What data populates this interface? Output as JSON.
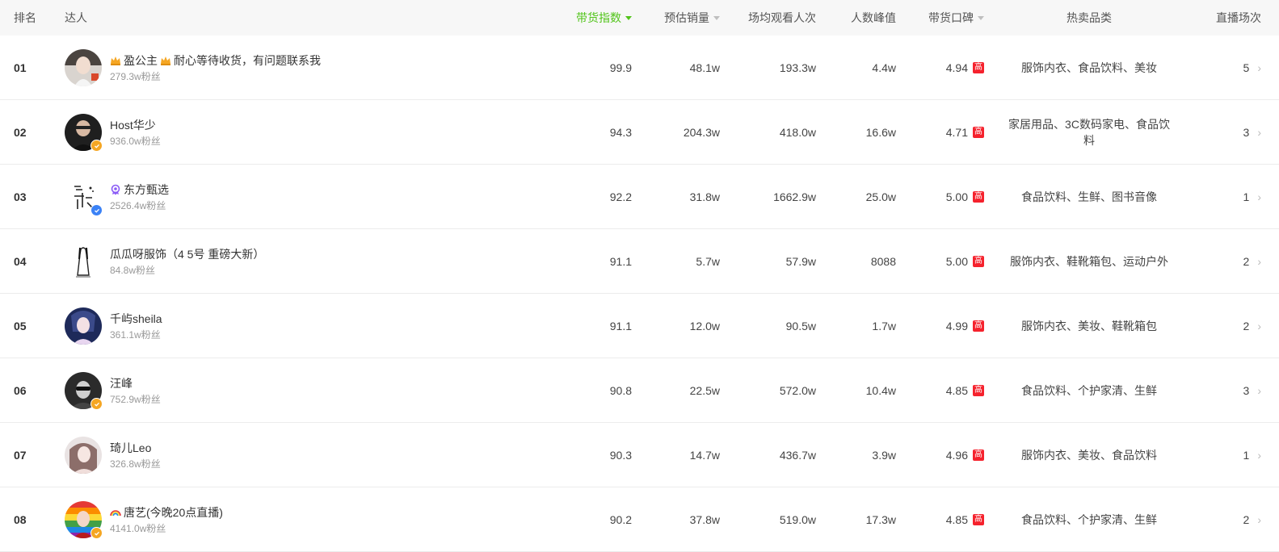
{
  "header": {
    "rank": "排名",
    "talent": "达人",
    "sales_index": "带货指数",
    "est_sales": "预估销量",
    "avg_views": "场均观看人次",
    "peak": "人数峰值",
    "reputation": "带货口碑",
    "hot_category": "热卖品类",
    "live_count": "直播场次"
  },
  "rows": [
    {
      "rank": "01",
      "name": "盈公主",
      "name_suffix": "耐心等待收货，有问题联系我",
      "fans": "279.3w粉丝",
      "index": "99.9",
      "sales": "48.1w",
      "views": "193.3w",
      "peak": "4.4w",
      "rep": "4.94",
      "rep_badge": "高",
      "category": "服饰内衣、食品饮料、美妆",
      "lives": "5"
    },
    {
      "rank": "02",
      "name": "Host华少",
      "fans": "936.0w粉丝",
      "index": "94.3",
      "sales": "204.3w",
      "views": "418.0w",
      "peak": "16.6w",
      "rep": "4.71",
      "rep_badge": "高",
      "category": "家居用品、3C数码家电、食品饮料",
      "lives": "3"
    },
    {
      "rank": "03",
      "name": "东方甄选",
      "fans": "2526.4w粉丝",
      "index": "92.2",
      "sales": "31.8w",
      "views": "1662.9w",
      "peak": "25.0w",
      "rep": "5.00",
      "rep_badge": "高",
      "category": "食品饮料、生鲜、图书音像",
      "lives": "1"
    },
    {
      "rank": "04",
      "name": "瓜瓜呀服饰（4 5号 重磅大新）",
      "fans": "84.8w粉丝",
      "index": "91.1",
      "sales": "5.7w",
      "views": "57.9w",
      "peak": "8088",
      "rep": "5.00",
      "rep_badge": "高",
      "category": "服饰内衣、鞋靴箱包、运动户外",
      "lives": "2"
    },
    {
      "rank": "05",
      "name": "千屿sheila",
      "fans": "361.1w粉丝",
      "index": "91.1",
      "sales": "12.0w",
      "views": "90.5w",
      "peak": "1.7w",
      "rep": "4.99",
      "rep_badge": "高",
      "category": "服饰内衣、美妆、鞋靴箱包",
      "lives": "2"
    },
    {
      "rank": "06",
      "name": "汪峰",
      "fans": "752.9w粉丝",
      "index": "90.8",
      "sales": "22.5w",
      "views": "572.0w",
      "peak": "10.4w",
      "rep": "4.85",
      "rep_badge": "高",
      "category": "食品饮料、个护家清、生鲜",
      "lives": "3"
    },
    {
      "rank": "07",
      "name": "琦儿Leo",
      "fans": "326.8w粉丝",
      "index": "90.3",
      "sales": "14.7w",
      "views": "436.7w",
      "peak": "3.9w",
      "rep": "4.96",
      "rep_badge": "高",
      "category": "服饰内衣、美妆、食品饮料",
      "lives": "1"
    },
    {
      "rank": "08",
      "name": "唐艺(今晚20点直播)",
      "fans": "4141.0w粉丝",
      "index": "90.2",
      "sales": "37.8w",
      "views": "519.0w",
      "peak": "17.3w",
      "rep": "4.85",
      "rep_badge": "高",
      "category": "食品饮料、个护家清、生鲜",
      "lives": "2"
    }
  ],
  "colors": {
    "accent_green": "#52c41a",
    "badge_red": "#f5222d",
    "header_bg": "#f7f7f7",
    "verify_gold": "#f5a623",
    "verify_blue": "#3b82f6"
  }
}
